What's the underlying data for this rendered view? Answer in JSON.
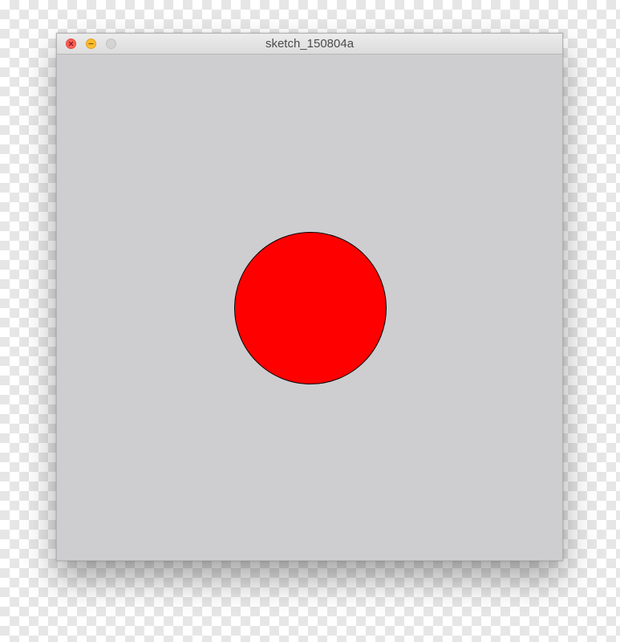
{
  "window": {
    "title": "sketch_150804a",
    "background_color": "#cecdd0"
  },
  "controls": {
    "close_icon": "close-icon",
    "minimize_icon": "minimize-icon",
    "zoom_icon": "zoom-icon",
    "close_color": "#fc5f57",
    "minimize_color": "#fdbc2e",
    "zoom_color": "#d4d4d4"
  },
  "sketch": {
    "shape": "circle",
    "fill_color": "#ff0000",
    "stroke_color": "#000000"
  }
}
